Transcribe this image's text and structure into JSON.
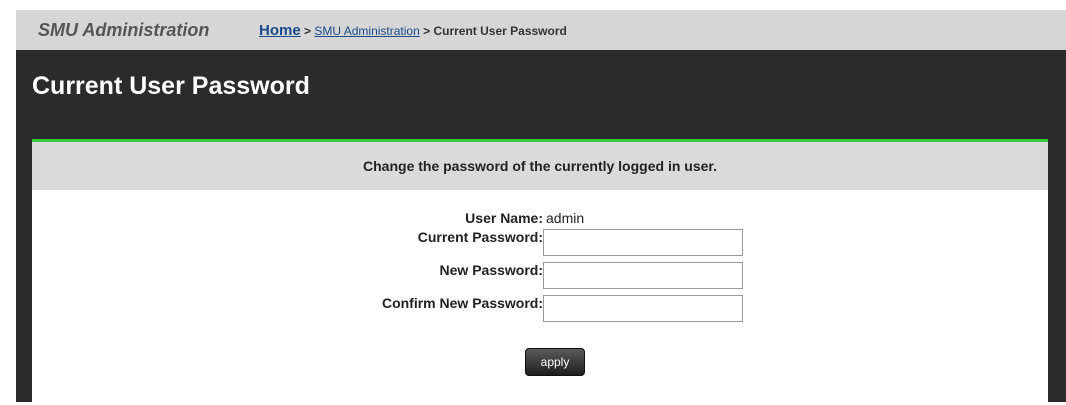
{
  "header": {
    "app_title": "SMU Administration",
    "breadcrumb": {
      "home": "Home",
      "separator": ">",
      "parent": "SMU Administration",
      "current": "Current User Password"
    }
  },
  "page_title": "Current User Password",
  "panel": {
    "description": "Change the password of the currently logged in user.",
    "user_name_label": "User Name:",
    "user_name_value": "admin",
    "current_password_label": "Current Password:",
    "current_password_value": "",
    "new_password_label": "New Password:",
    "new_password_value": "",
    "confirm_password_label": "Confirm New Password:",
    "confirm_password_value": "",
    "apply_label": "apply"
  },
  "colors": {
    "top_bar": "#d6d6d6",
    "frame_background": "#2b2b2b",
    "accent_line": "#3cc83c",
    "link": "#1a4a8a",
    "panel_header": "#d9dadb"
  }
}
